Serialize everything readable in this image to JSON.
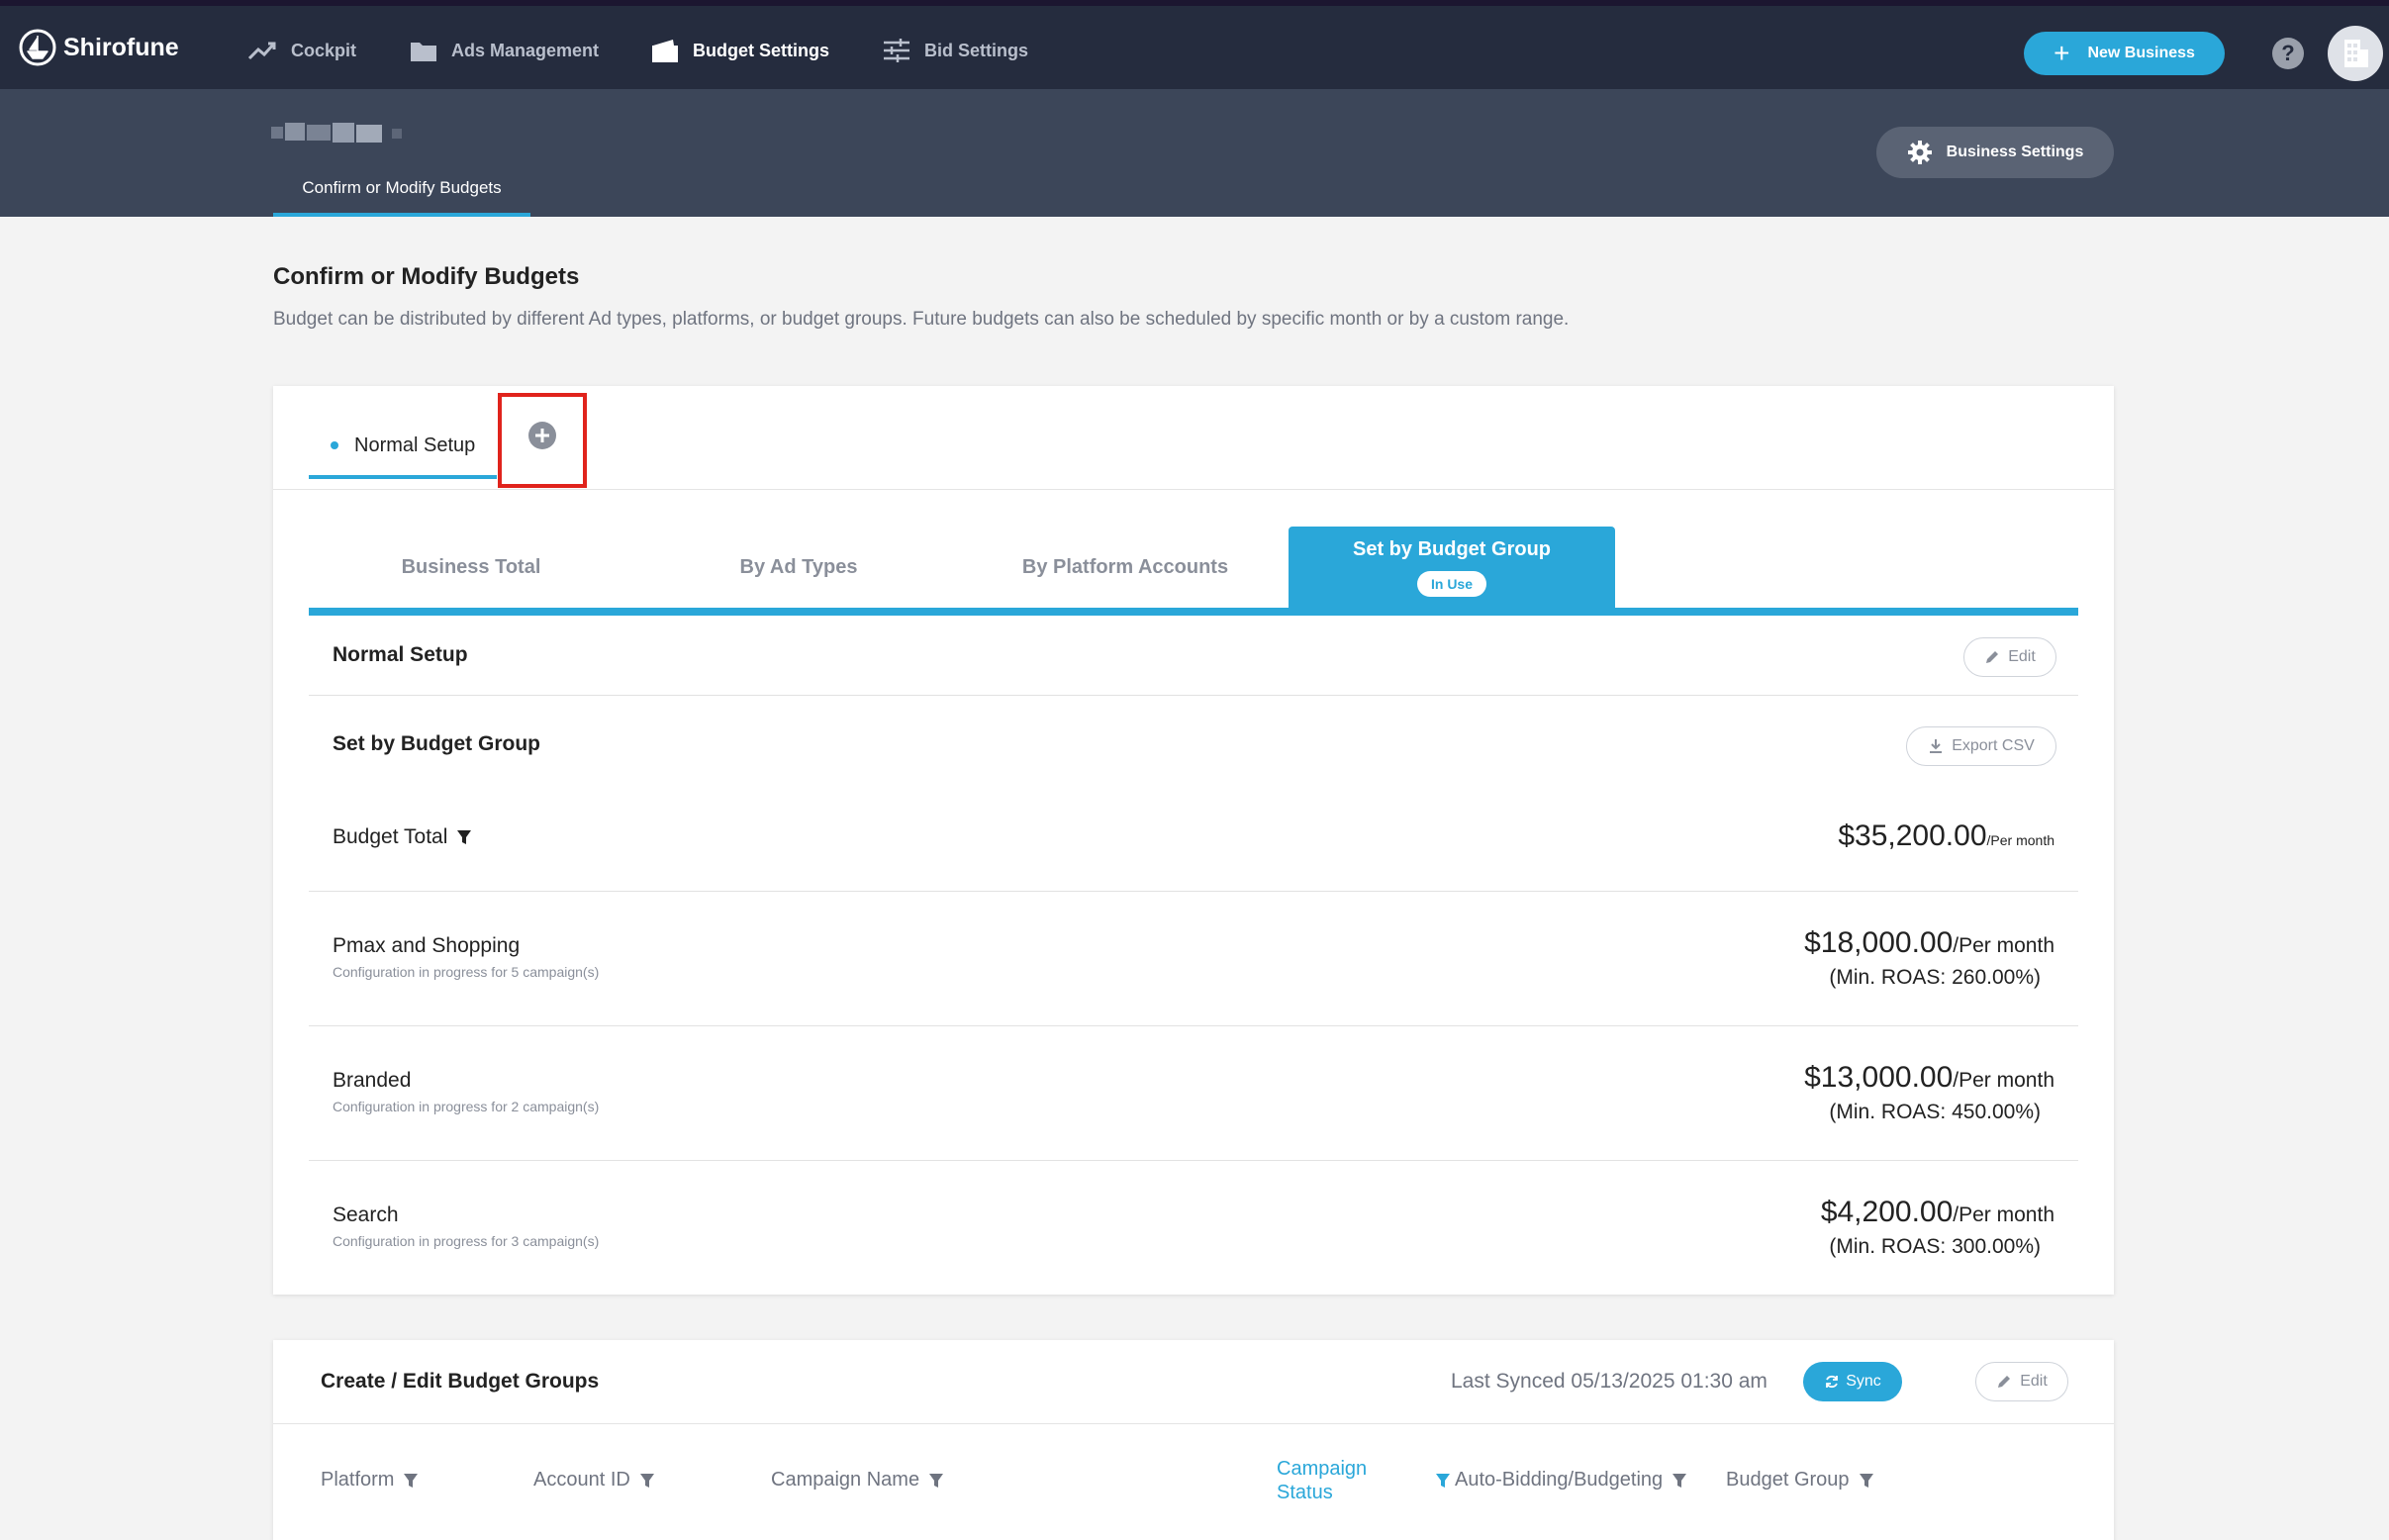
{
  "brand": {
    "name": "Shirofune"
  },
  "nav": {
    "items": [
      {
        "label": "Cockpit",
        "icon": "trend-icon"
      },
      {
        "label": "Ads Management",
        "icon": "folder-icon"
      },
      {
        "label": "Budget Settings",
        "icon": "wallet-icon",
        "active": true
      },
      {
        "label": "Bid Settings",
        "icon": "sliders-icon"
      }
    ],
    "new_business_label": "New Business",
    "help_label": "?"
  },
  "subheader": {
    "tab_label": "Confirm or Modify Budgets",
    "business_settings_label": "Business Settings"
  },
  "page": {
    "title": "Confirm or Modify Budgets",
    "description": "Budget can be distributed by different Ad types, platforms, or budget groups. Future budgets can also be scheduled by specific month or by a custom range."
  },
  "setup_tabs": {
    "active_label": "Normal Setup"
  },
  "mode_tabs": {
    "items": [
      "Business Total",
      "By Ad Types",
      "By Platform Accounts"
    ],
    "active_label": "Set by Budget Group",
    "active_badge": "In Use"
  },
  "budget": {
    "setup_title": "Normal Setup",
    "edit_label": "Edit",
    "section_title": "Set by Budget Group",
    "export_label": "Export CSV",
    "total_label": "Budget Total",
    "total_amount": "$35,200.00",
    "total_period": "/Per month",
    "groups": [
      {
        "name": "Pmax and Shopping",
        "sub": "Configuration in progress for 5 campaign(s)",
        "amount": "$18,000.00",
        "period": "/Per month",
        "roas": "(Min. ROAS: 260.00%)"
      },
      {
        "name": "Branded",
        "sub": "Configuration in progress for 2 campaign(s)",
        "amount": "$13,000.00",
        "period": "/Per month",
        "roas": "(Min. ROAS: 450.00%)"
      },
      {
        "name": "Search",
        "sub": "Configuration in progress for 3 campaign(s)",
        "amount": "$4,200.00",
        "period": "/Per month",
        "roas": "(Min. ROAS: 300.00%)"
      }
    ]
  },
  "groups_card": {
    "title": "Create / Edit Budget Groups",
    "last_synced": "Last Synced 05/13/2025 01:30 am",
    "sync_label": "Sync",
    "edit_label": "Edit",
    "columns": {
      "platform": "Platform",
      "account_id": "Account ID",
      "campaign_name": "Campaign Name",
      "campaign_status_1": "Campaign",
      "campaign_status_2": "Status",
      "auto_bidding": "Auto-Bidding/Budgeting",
      "budget_group": "Budget Group"
    }
  },
  "colors": {
    "accent": "#2aa7d9",
    "nav_bg": "#252c3e",
    "subhead_bg": "#3c4659",
    "highlight": "#e0231c"
  }
}
